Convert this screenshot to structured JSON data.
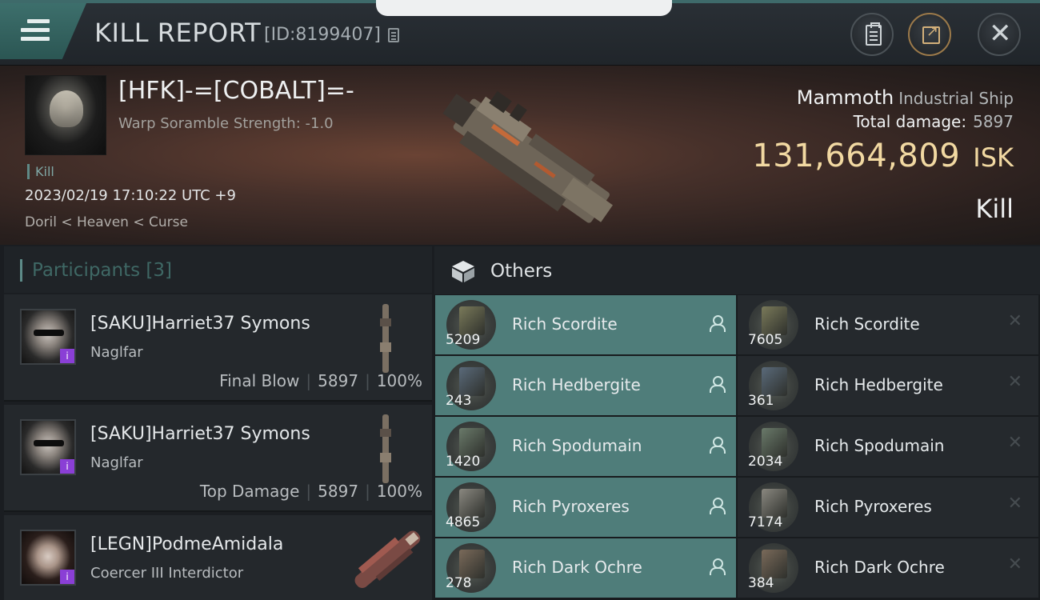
{
  "topbar": {
    "title": "KILL REPORT",
    "report_id": "[ID:8199407]",
    "icons": [
      "menu-icon",
      "copy-icon",
      "clipboard-icon",
      "share-icon",
      "close-icon"
    ]
  },
  "victim": {
    "name": "[HFK]-=[COBALT]=-",
    "scramble": "Warp Soramble Strength: -1.0",
    "tag": "Kill",
    "datetime": "2023/02/19 17:10:22 UTC +9",
    "location": "Doril < Heaven < Curse",
    "ship_name": "Mammoth",
    "ship_class": "Industrial Ship",
    "damage_label": "Total damage:",
    "damage_value": "5897",
    "isk_amount": "131,664,809",
    "isk_unit": "ISK",
    "result": "Kill"
  },
  "participants": {
    "title": "Participants [3]",
    "rows": [
      {
        "name": "[SAKU]Harriet37 Symons",
        "ship": "Naglfar",
        "label": "Final Blow",
        "damage": "5897",
        "percent": "100%"
      },
      {
        "name": "[SAKU]Harriet37 Symons",
        "ship": "Naglfar",
        "label": "Top Damage",
        "damage": "5897",
        "percent": "100%"
      },
      {
        "name": "[LEGN]PodmeAmidala",
        "ship": "Coercer III Interdictor",
        "label": "",
        "damage": "",
        "percent": ""
      }
    ]
  },
  "others": {
    "title": "Others",
    "dropped": [
      {
        "name": "Rich Scordite",
        "qty": "5209",
        "color": "#7a7a5a"
      },
      {
        "name": "Rich Hedbergite",
        "qty": "243",
        "color": "#5a6a7a"
      },
      {
        "name": "Rich Spodumain",
        "qty": "1420",
        "color": "#6a7a6a"
      },
      {
        "name": "Rich Pyroxeres",
        "qty": "4865",
        "color": "#8a8880"
      },
      {
        "name": "Rich Dark Ochre",
        "qty": "278",
        "color": "#7a6a5a"
      }
    ],
    "destroyed": [
      {
        "name": "Rich Scordite",
        "qty": "7605",
        "color": "#7a7a5a"
      },
      {
        "name": "Rich Hedbergite",
        "qty": "361",
        "color": "#5a6a7a"
      },
      {
        "name": "Rich Spodumain",
        "qty": "2034",
        "color": "#6a7a6a"
      },
      {
        "name": "Rich Pyroxeres",
        "qty": "7174",
        "color": "#8a8880"
      },
      {
        "name": "Rich Dark Ochre",
        "qty": "384",
        "color": "#7a6a5a"
      }
    ]
  },
  "colors": {
    "accent": "#5d8b88",
    "isk_gold": "#f2d9a2",
    "dropped_bg": "#4f7d7a",
    "badge_purple": "#8a3fd6"
  }
}
